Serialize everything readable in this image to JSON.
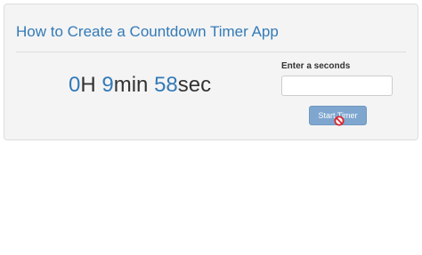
{
  "panel": {
    "title": "How to Create a Countdown Timer App"
  },
  "timer": {
    "hours": "0",
    "hours_unit": "H",
    "minutes": "9",
    "minutes_unit": "min",
    "seconds": "58",
    "seconds_unit": "sec"
  },
  "form": {
    "label": "Enter a seconds",
    "input_value": "",
    "button_label": "Start Timer"
  },
  "cursor": {
    "icon": "not-allowed-cursor-icon"
  },
  "colors": {
    "accent": "#337ab7",
    "panel_bg": "#f4f4f4",
    "button_bg": "#7ea6cf",
    "cursor_red": "#d9262c"
  }
}
